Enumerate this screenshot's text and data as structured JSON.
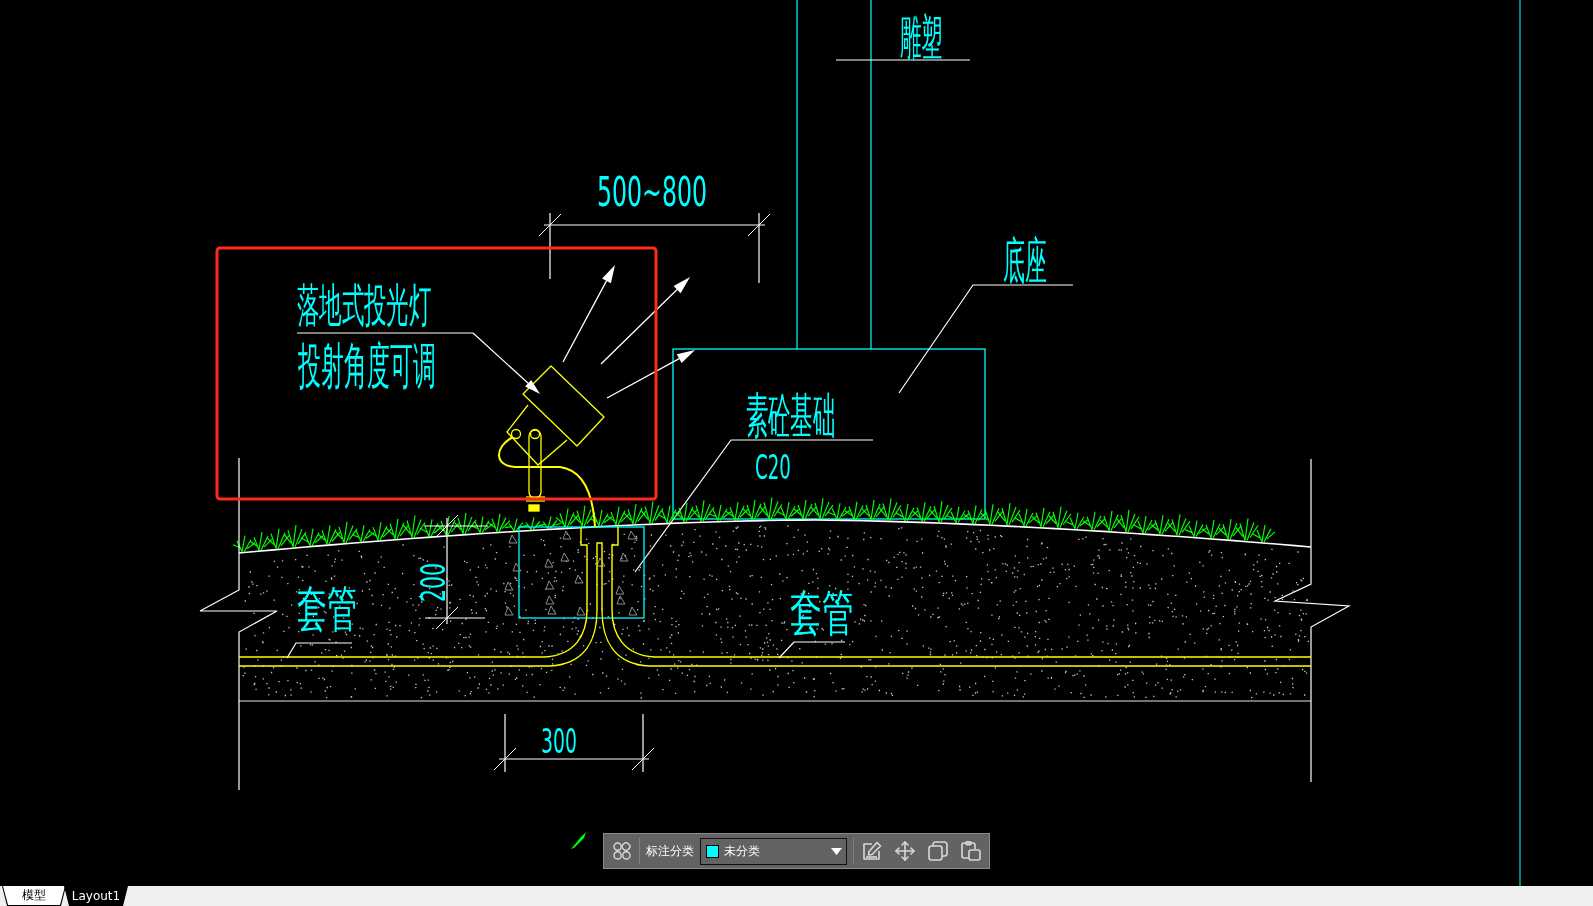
{
  "drawing": {
    "sculpture_label": "雕塑",
    "span_dimension": "500~800",
    "lamp_callout": [
      "落地式投光灯",
      "投射角度可调"
    ],
    "base_label": "底座",
    "foundation_label": "素砼基础",
    "concrete_grade": "C20",
    "depth_dimension": "200",
    "conduit_labels": [
      "套管",
      "套管"
    ],
    "footing_dimension": "300"
  },
  "toolbar": {
    "label": "标注分类",
    "category": "未分类"
  },
  "tabs": [
    {
      "label": "模型",
      "selected": true
    },
    {
      "label": "Layout1",
      "selected": false
    }
  ]
}
